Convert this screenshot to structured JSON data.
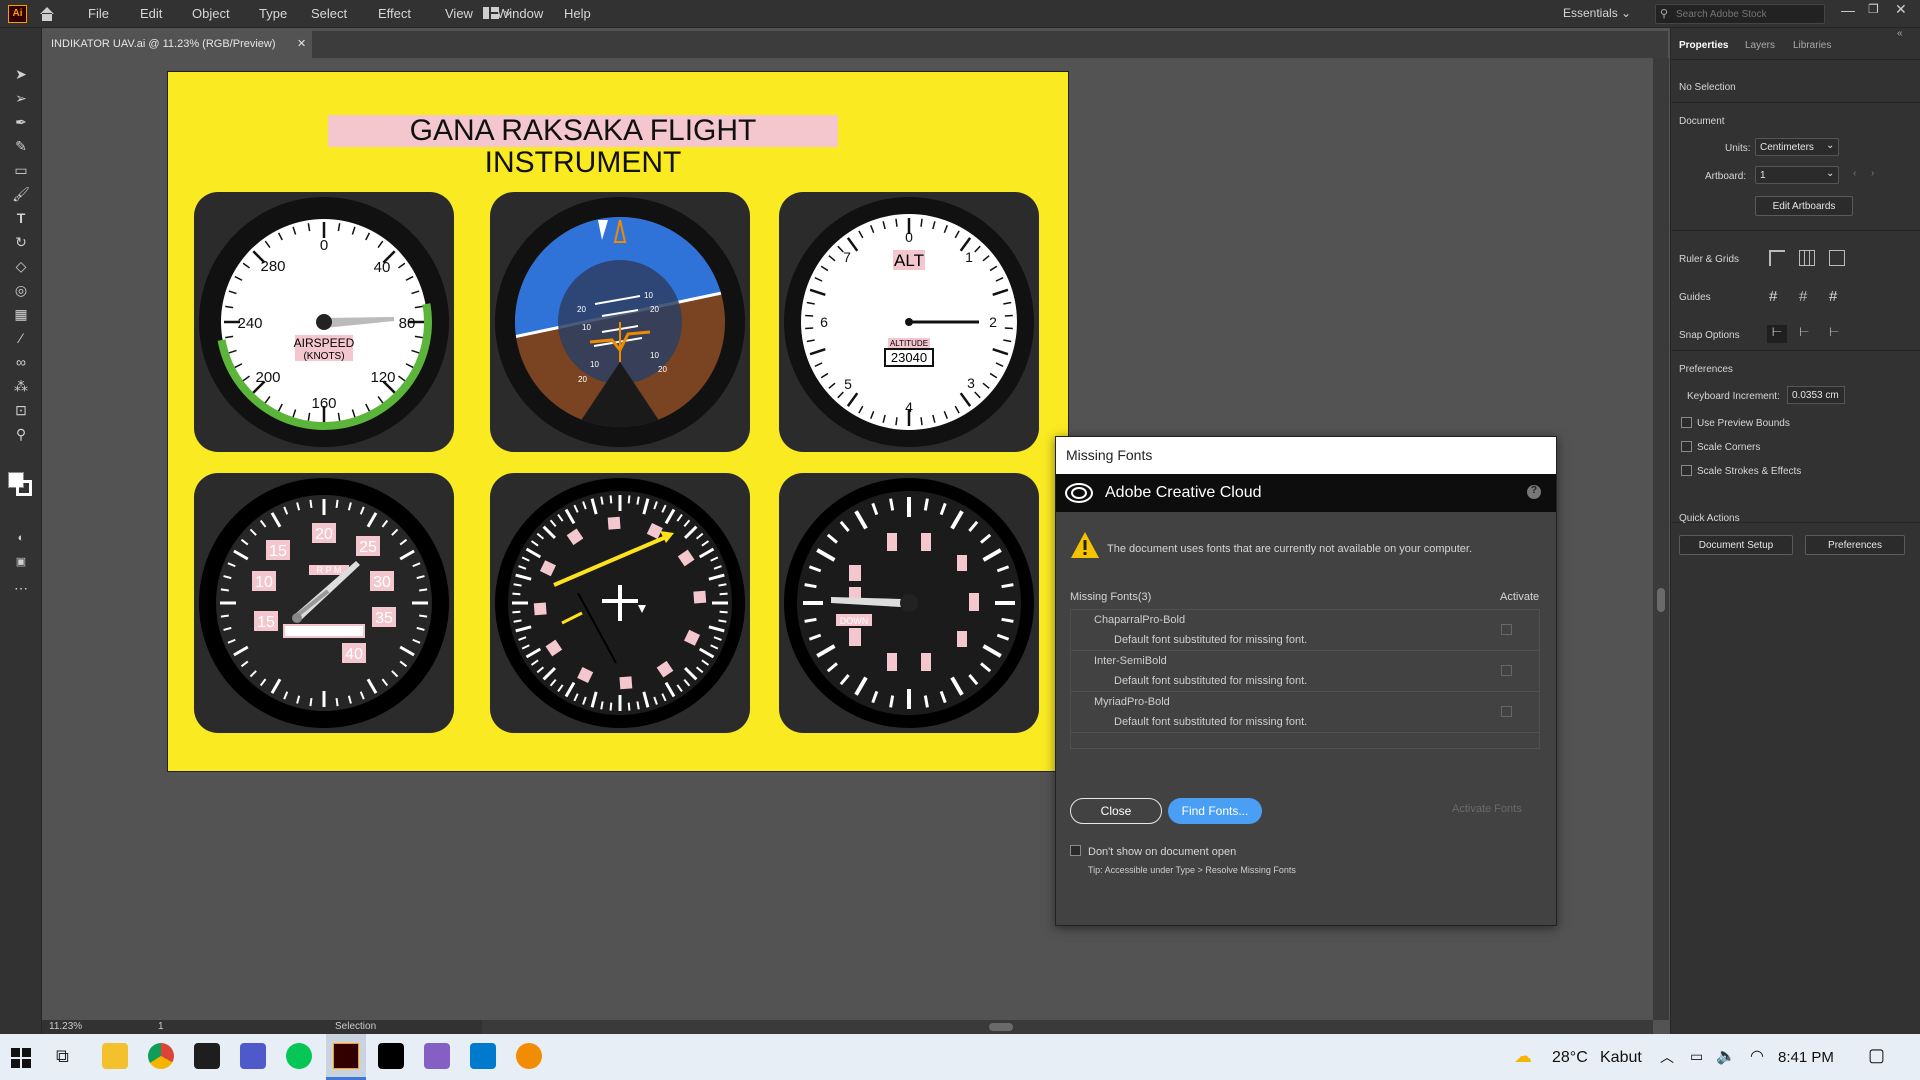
{
  "app": {
    "logo": "Ai"
  },
  "menu": [
    "File",
    "Edit",
    "Object",
    "Type",
    "Select",
    "Effect",
    "View",
    "Window",
    "Help"
  ],
  "workspace": "Essentials",
  "search": {
    "placeholder": "Search Adobe Stock"
  },
  "document_tab": "INDIKATOR UAV.ai @ 11.23% (RGB/Preview)",
  "statusbar": {
    "zoom": "11.23%",
    "artboard": "1",
    "tool": "Selection"
  },
  "panel": {
    "tabs": [
      "Properties",
      "Layers",
      "Libraries"
    ],
    "no_selection": "No Selection",
    "document_heading": "Document",
    "units_label": "Units:",
    "units_value": "Centimeters",
    "artboard_label": "Artboard:",
    "artboard_value": "1",
    "edit_artboards": "Edit Artboards",
    "rulers_grids": "Ruler & Grids",
    "guides": "Guides",
    "snap_options": "Snap Options",
    "preferences_heading": "Preferences",
    "keyboard_increment_label": "Keyboard Increment:",
    "keyboard_increment_value": "0.0353 cm",
    "use_preview_bounds": "Use Preview Bounds",
    "scale_corners": "Scale Corners",
    "scale_strokes": "Scale Strokes & Effects",
    "quick_actions": "Quick Actions",
    "document_setup": "Document Setup",
    "preferences_button": "Preferences"
  },
  "artboard": {
    "title": "GANA RAKSAKA FLIGHT INSTRUMENT",
    "airspeed": {
      "ticks": [
        "0",
        "40",
        "80",
        "120",
        "160",
        "200",
        "240",
        "280"
      ],
      "label": "AIRSPEED",
      "sublabel": "(KNOTS)"
    },
    "attitude": {
      "pitch_labels": [
        "20",
        "10",
        "10",
        "20",
        "10",
        "20",
        "10",
        "20"
      ]
    },
    "altimeter": {
      "ticks": [
        "0",
        "1",
        "2",
        "3",
        "4",
        "5",
        "6",
        "7"
      ],
      "label": "ALT",
      "sublabel": "ALTITUDE",
      "value": "23040"
    },
    "tachometer": {
      "ticks": [
        "10",
        "15",
        "20",
        "25",
        "30",
        "35",
        "40",
        "15"
      ],
      "label": "R P M"
    },
    "vsi": {
      "label": "DOWN"
    }
  },
  "dialog": {
    "title": "Missing Fonts",
    "brand": "Adobe Creative Cloud",
    "warning": "The document uses fonts that are currently not available on your computer.",
    "missing_header": "Missing Fonts(3)",
    "activate_header": "Activate",
    "fonts": [
      {
        "name": "ChaparralPro-Bold",
        "note": "Default font substituted for missing font."
      },
      {
        "name": "Inter-SemiBold",
        "note": "Default font substituted for missing font."
      },
      {
        "name": "MyriadPro-Bold",
        "note": "Default font substituted for missing font."
      }
    ],
    "close": "Close",
    "find_fonts": "Find Fonts...",
    "activate_fonts": "Activate Fonts",
    "dont_show": "Don't show on document open",
    "tip": "Tip: Accessible under Type > Resolve Missing Fonts",
    "help": "?"
  },
  "taskbar": {
    "weather_temp": "28°C",
    "weather_desc": "Kabut",
    "time": "8:41 PM"
  }
}
